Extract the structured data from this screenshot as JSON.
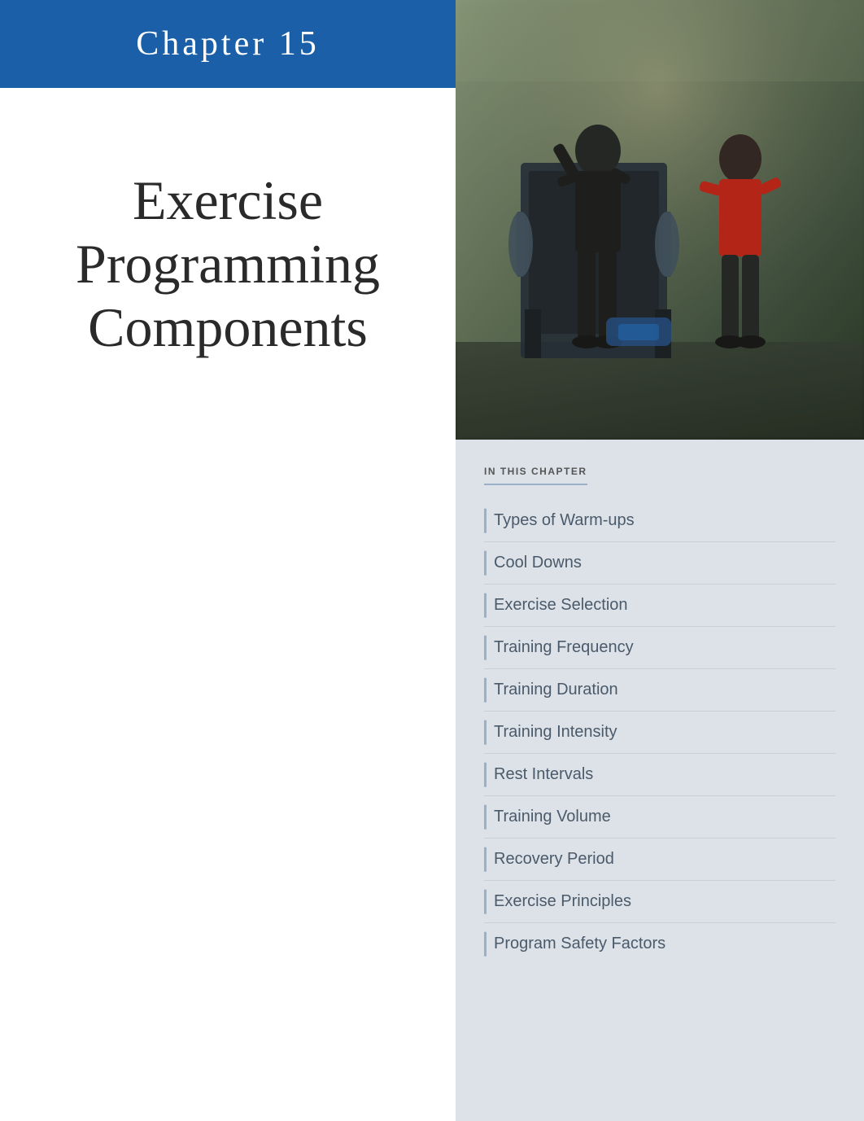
{
  "chapter": {
    "number": "Chapter  15",
    "title_line1": "Exercise",
    "title_line2": "Programming",
    "title_line3": "Components"
  },
  "sidebar": {
    "section_label": "IN THIS CHAPTER",
    "items": [
      {
        "id": "warm-ups",
        "label": "Types of Warm-ups"
      },
      {
        "id": "cool-downs",
        "label": "Cool Downs"
      },
      {
        "id": "exercise-selection",
        "label": "Exercise Selection"
      },
      {
        "id": "training-frequency",
        "label": "Training Frequency"
      },
      {
        "id": "training-duration",
        "label": "Training Duration"
      },
      {
        "id": "training-intensity",
        "label": "Training Intensity"
      },
      {
        "id": "rest-intervals",
        "label": "Rest Intervals"
      },
      {
        "id": "training-volume",
        "label": "Training Volume"
      },
      {
        "id": "recovery-period",
        "label": "Recovery Period"
      },
      {
        "id": "exercise-principles",
        "label": "Exercise Principles"
      },
      {
        "id": "program-safety-factors",
        "label": "Program Safety Factors"
      }
    ]
  },
  "colors": {
    "header_blue": "#1a5fa8",
    "sidebar_bg": "#dde2e8",
    "accent_line": "#9ab0c8",
    "nav_text": "#4a5a6a",
    "chapter_text": "#fff",
    "main_title": "#2a2a2a"
  }
}
